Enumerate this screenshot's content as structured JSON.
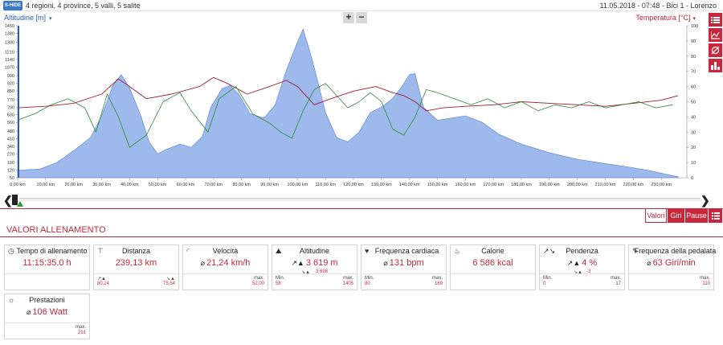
{
  "header": {
    "logo": "S-HIDE",
    "title": "4 regioni, 4 province, 5 valli, 5 salite",
    "date": "11.05.2018",
    "time": "07:48",
    "bike": "Bici 1",
    "user": "Lorenzo"
  },
  "chart": {
    "left_axis_title": "Altitudine [m]",
    "right_axis_title": "Temperatura [°C]",
    "zoom_in": "+",
    "zoom_out": "−",
    "side_icons": [
      "list-icon",
      "line-chart-icon",
      "no-pin-icon",
      "bar-chart-icon"
    ]
  },
  "chart_data": {
    "type": "line",
    "x_unit": "km",
    "x_ticks": [
      "0,00 km",
      "10,00 km",
      "20,00 km",
      "30,00 km",
      "40,00 km",
      "50,00 km",
      "60,00 km",
      "70,00 km",
      "80,00 km",
      "90,00 km",
      "100,00 km",
      "110,00 km",
      "120,00 km",
      "130,00 km",
      "140,00 km",
      "150,00 km",
      "160,00 km",
      "170,00 km",
      "180,00 km",
      "190,00 km",
      "200,00 km",
      "210,00 km",
      "220,00 km",
      "230,00 km"
    ],
    "x_range": [
      0,
      239.13
    ],
    "y_left_ticks": [
      1450,
      1380,
      1300,
      1210,
      1140,
      1070,
      990,
      920,
      850,
      770,
      700,
      630,
      560,
      480,
      410,
      340,
      270,
      190,
      120,
      50
    ],
    "y_left_range": [
      50,
      1450
    ],
    "y_right_ticks": [
      100,
      90,
      80,
      70,
      60,
      50,
      40,
      30,
      20,
      10,
      0
    ],
    "y_right_range": [
      0,
      100
    ],
    "series": [
      {
        "name": "Altitudine [m]",
        "axis": "left",
        "color": "#7da1e6",
        "points": [
          [
            0,
            120
          ],
          [
            8,
            130
          ],
          [
            14,
            190
          ],
          [
            20,
            300
          ],
          [
            26,
            420
          ],
          [
            30,
            620
          ],
          [
            34,
            900
          ],
          [
            37,
            1000
          ],
          [
            40,
            880
          ],
          [
            44,
            620
          ],
          [
            47,
            380
          ],
          [
            50,
            270
          ],
          [
            53,
            310
          ],
          [
            58,
            360
          ],
          [
            62,
            330
          ],
          [
            66,
            430
          ],
          [
            69,
            700
          ],
          [
            73,
            870
          ],
          [
            76,
            900
          ],
          [
            79,
            820
          ],
          [
            83,
            640
          ],
          [
            88,
            600
          ],
          [
            92,
            720
          ],
          [
            96,
            1040
          ],
          [
            100,
            1300
          ],
          [
            102,
            1420
          ],
          [
            105,
            1160
          ],
          [
            108,
            860
          ],
          [
            110,
            650
          ],
          [
            114,
            420
          ],
          [
            118,
            380
          ],
          [
            122,
            470
          ],
          [
            126,
            650
          ],
          [
            130,
            700
          ],
          [
            134,
            780
          ],
          [
            137,
            880
          ],
          [
            140,
            1000
          ],
          [
            142,
            1010
          ],
          [
            145,
            700
          ],
          [
            150,
            580
          ],
          [
            155,
            600
          ],
          [
            160,
            620
          ],
          [
            166,
            560
          ],
          [
            172,
            450
          ],
          [
            180,
            360
          ],
          [
            190,
            280
          ],
          [
            200,
            220
          ],
          [
            210,
            180
          ],
          [
            218,
            150
          ],
          [
            225,
            120
          ],
          [
            232,
            80
          ],
          [
            236,
            60
          ]
        ]
      },
      {
        "name": "Temperatura [°C]",
        "axis": "right",
        "color": "#9e1a36",
        "points": [
          [
            0,
            46
          ],
          [
            10,
            47
          ],
          [
            20,
            49
          ],
          [
            30,
            55
          ],
          [
            36,
            65
          ],
          [
            40,
            60
          ],
          [
            46,
            52
          ],
          [
            55,
            55
          ],
          [
            65,
            60
          ],
          [
            70,
            66
          ],
          [
            75,
            62
          ],
          [
            82,
            55
          ],
          [
            90,
            60
          ],
          [
            96,
            64
          ],
          [
            100,
            60
          ],
          [
            106,
            48
          ],
          [
            112,
            52
          ],
          [
            120,
            57
          ],
          [
            128,
            60
          ],
          [
            134,
            56
          ],
          [
            138,
            54
          ],
          [
            142,
            50
          ],
          [
            146,
            44
          ],
          [
            152,
            46
          ],
          [
            160,
            47
          ],
          [
            170,
            48
          ],
          [
            180,
            50
          ],
          [
            190,
            49
          ],
          [
            200,
            48
          ],
          [
            210,
            47
          ],
          [
            220,
            49
          ],
          [
            230,
            51
          ],
          [
            236,
            54
          ]
        ]
      },
      {
        "name": "Frequenza cardiaca",
        "axis": "right",
        "color": "#2a8a35",
        "points": [
          [
            0,
            38
          ],
          [
            6,
            42
          ],
          [
            12,
            48
          ],
          [
            18,
            52
          ],
          [
            24,
            46
          ],
          [
            28,
            30
          ],
          [
            32,
            55
          ],
          [
            36,
            40
          ],
          [
            40,
            20
          ],
          [
            46,
            28
          ],
          [
            52,
            50
          ],
          [
            58,
            56
          ],
          [
            62,
            44
          ],
          [
            68,
            30
          ],
          [
            72,
            52
          ],
          [
            78,
            60
          ],
          [
            84,
            42
          ],
          [
            90,
            36
          ],
          [
            94,
            30
          ],
          [
            98,
            26
          ],
          [
            102,
            44
          ],
          [
            106,
            58
          ],
          [
            110,
            62
          ],
          [
            114,
            54
          ],
          [
            118,
            46
          ],
          [
            122,
            50
          ],
          [
            126,
            56
          ],
          [
            130,
            50
          ],
          [
            134,
            32
          ],
          [
            138,
            28
          ],
          [
            142,
            40
          ],
          [
            146,
            58
          ],
          [
            150,
            56
          ],
          [
            156,
            52
          ],
          [
            162,
            48
          ],
          [
            168,
            52
          ],
          [
            174,
            46
          ],
          [
            180,
            50
          ],
          [
            186,
            44
          ],
          [
            192,
            48
          ],
          [
            198,
            46
          ],
          [
            204,
            50
          ],
          [
            210,
            46
          ],
          [
            216,
            48
          ],
          [
            222,
            50
          ],
          [
            228,
            46
          ],
          [
            234,
            48
          ]
        ]
      }
    ]
  },
  "tabs": [
    "Valori",
    "Giri",
    "Pause"
  ],
  "section_title": "VALORI ALLENAMENTO",
  "cards": {
    "tempo": {
      "title": "Tempo di allenamento",
      "value": "11:15:35.0 h"
    },
    "distanza": {
      "title": "Distanza",
      "value": "239,13 km",
      "up": "80,24",
      "down": "75,54"
    },
    "velocita": {
      "title": "Velocità",
      "avg_label": "⌀",
      "value": "21,24 km/h",
      "max_label": "max.",
      "max": "52,00"
    },
    "altitudine": {
      "title": "Altitudine",
      "value": "3 619 m",
      "down_val": "3 698",
      "min_label": "Min.",
      "min": "58",
      "max_label": "max.",
      "max": "1405"
    },
    "fc": {
      "title": "Frequenza cardiaca",
      "avg_label": "⌀",
      "value": "131 bpm",
      "min_label": "Min.",
      "min": "80",
      "max_label": "max.",
      "max": "169"
    },
    "calorie": {
      "title": "Calorie",
      "value": "6 586 kcal"
    },
    "pendenza": {
      "title": "Pendenza",
      "value": "4 %",
      "down_val": "-3",
      "min_label": "Min.",
      "min": "0",
      "max_label": "max.",
      "max": "17"
    },
    "pedalata": {
      "title": "Frequenza della pedalata",
      "avg_label": "⌀",
      "value": "63 Giri/min",
      "max_label": "max.",
      "max": "110"
    },
    "prestazioni": {
      "title": "Prestazioni",
      "avg_label": "⌀",
      "value": "106 Watt",
      "max_label": "max.",
      "max": "291"
    }
  },
  "colors": {
    "accent": "#c9253b",
    "altitude": "#7da1e6",
    "temperature": "#9e1a36",
    "heart": "#2a8a35"
  }
}
